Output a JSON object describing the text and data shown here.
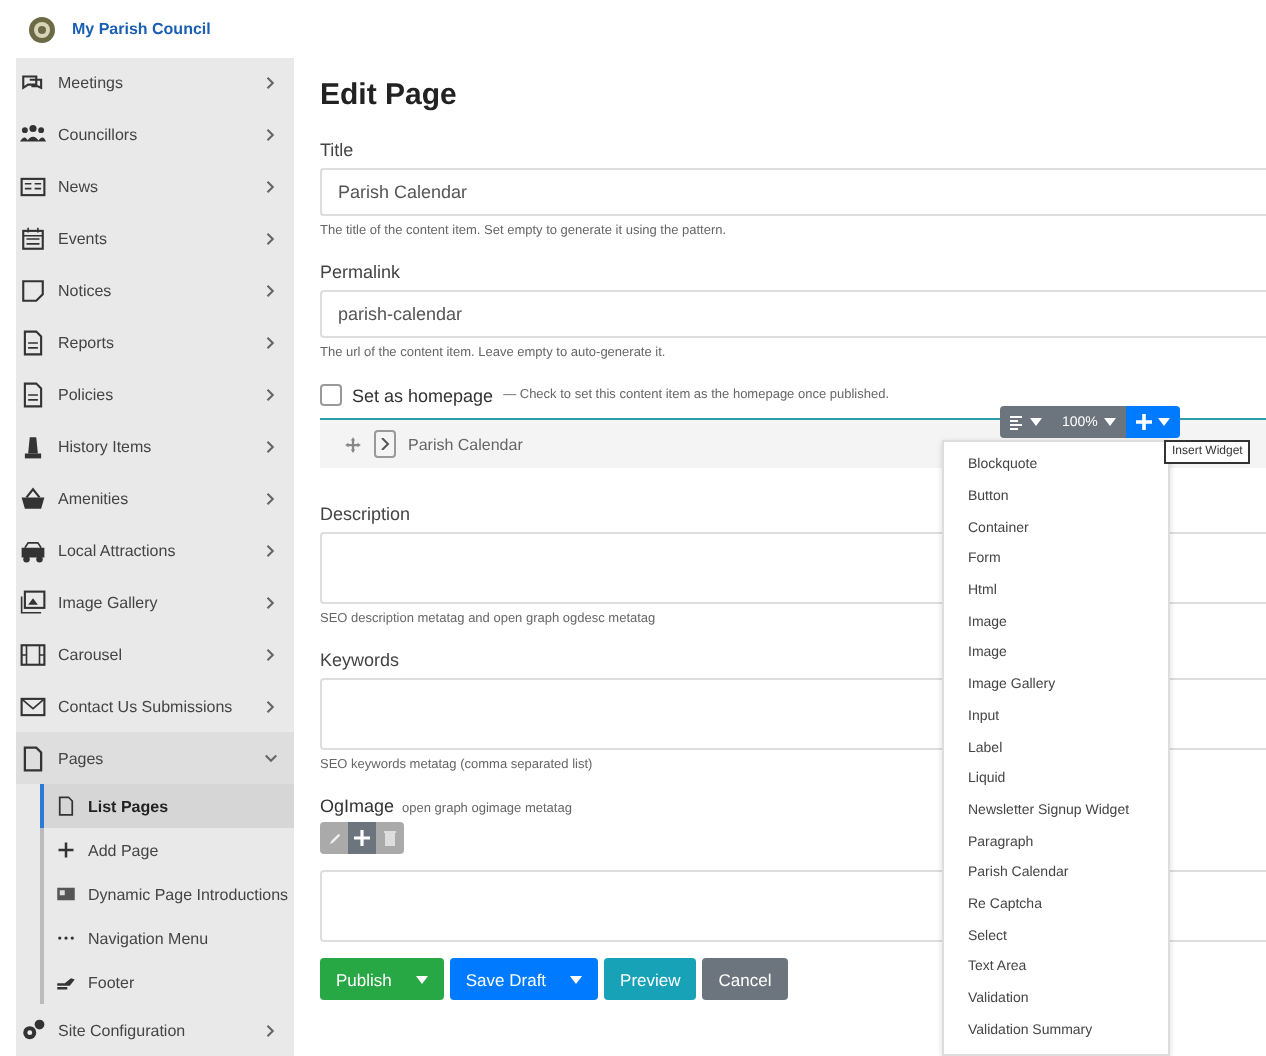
{
  "header": {
    "title": "My Parish Council"
  },
  "sidebar": {
    "items": [
      {
        "label": "Meetings",
        "expanded": false
      },
      {
        "label": "Councillors",
        "expanded": false
      },
      {
        "label": "News",
        "expanded": false
      },
      {
        "label": "Events",
        "expanded": false
      },
      {
        "label": "Notices",
        "expanded": false
      },
      {
        "label": "Reports",
        "expanded": false
      },
      {
        "label": "Policies",
        "expanded": false
      },
      {
        "label": "History Items",
        "expanded": false
      },
      {
        "label": "Amenities",
        "expanded": false
      },
      {
        "label": "Local Attractions",
        "expanded": false
      },
      {
        "label": "Image Gallery",
        "expanded": false
      },
      {
        "label": "Carousel",
        "expanded": false
      },
      {
        "label": "Contact Us Submissions",
        "expanded": false
      },
      {
        "label": "Pages",
        "expanded": true,
        "children": [
          {
            "label": "List Pages",
            "selected": true
          },
          {
            "label": "Add Page",
            "selected": false
          },
          {
            "label": "Dynamic Page Introductions",
            "selected": false
          },
          {
            "label": "Navigation Menu",
            "selected": false
          },
          {
            "label": "Footer",
            "selected": false
          }
        ]
      },
      {
        "label": "Site Configuration",
        "expanded": false
      }
    ]
  },
  "page": {
    "heading": "Edit Page",
    "title_field": {
      "label": "Title",
      "value": "Parish Calendar",
      "help": "The title of the content item. Set empty to generate it using the pattern."
    },
    "permalink_field": {
      "label": "Permalink",
      "value": "parish-calendar",
      "help": "The url of the content item. Leave empty to auto-generate it."
    },
    "homepage": {
      "label": "Set as homepage",
      "hint": "— Check to set this content item as the homepage once published.",
      "checked": false
    },
    "widget": {
      "title": "Parish Calendar",
      "zoom": "100%",
      "tooltip": "Insert Widget"
    },
    "widget_menu": [
      "Blockquote",
      "Button",
      "Container",
      "Form",
      "Html",
      "Image",
      "Image",
      "Image Gallery",
      "Input",
      "Label",
      "Liquid",
      "Newsletter Signup Widget",
      "Paragraph",
      "Parish Calendar",
      "Re Captcha",
      "Select",
      "Text Area",
      "Validation",
      "Validation Summary"
    ],
    "description_field": {
      "label": "Description",
      "help": "SEO description metatag and open graph ogdesc metatag"
    },
    "keywords_field": {
      "label": "Keywords",
      "help": "SEO keywords metatag (comma separated list)"
    },
    "ogimage_field": {
      "label": "OgImage",
      "hint": "open graph ogimage metatag"
    },
    "actions": [
      {
        "label": "Publish",
        "kind": "split",
        "color": "#28a745"
      },
      {
        "label": "Save Draft",
        "kind": "split",
        "color": "#007bff"
      },
      {
        "label": "Preview",
        "kind": "plain",
        "color": "#17a2b8"
      },
      {
        "label": "Cancel",
        "kind": "plain",
        "color": "#6c757d"
      }
    ]
  }
}
